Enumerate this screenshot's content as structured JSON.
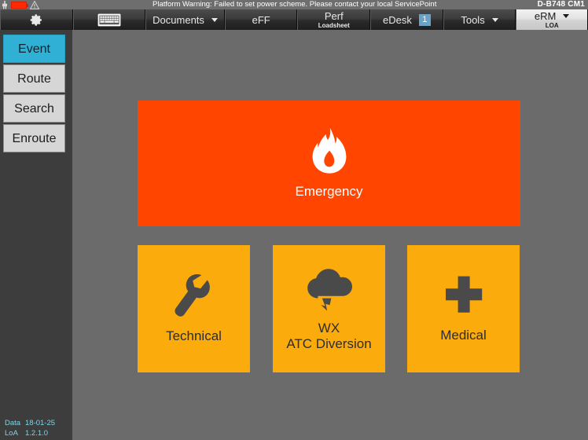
{
  "statusbar": {
    "icons": [
      "plug-icon",
      "battery-icon",
      "warning-triangle-icon"
    ],
    "message": "Platform Warning: Failed to set power scheme. Please contact your local ServicePoint",
    "aircraft_id": "D-B748",
    "crew_id": "CM1",
    "right_text": "D-B748   CM1"
  },
  "toolbar": {
    "items": [
      {
        "label": "",
        "sub": "",
        "icon": "gear-icon",
        "caret": false,
        "badge": null,
        "active": false,
        "name": "settings-button"
      },
      {
        "label": "",
        "sub": "",
        "icon": "keyboard-icon",
        "caret": false,
        "badge": null,
        "active": false,
        "name": "keyboard-button"
      },
      {
        "label": "Documents",
        "sub": "",
        "icon": null,
        "caret": true,
        "badge": null,
        "active": false,
        "name": "tab-documents"
      },
      {
        "label": "eFF",
        "sub": "",
        "icon": null,
        "caret": false,
        "badge": null,
        "active": false,
        "name": "tab-eff"
      },
      {
        "label": "Perf",
        "sub": "Loadsheet",
        "icon": null,
        "caret": false,
        "badge": null,
        "active": false,
        "name": "tab-perf"
      },
      {
        "label": "eDesk",
        "sub": "",
        "icon": null,
        "caret": false,
        "badge": "1",
        "active": false,
        "name": "tab-edesk"
      },
      {
        "label": "Tools",
        "sub": "",
        "icon": null,
        "caret": true,
        "badge": null,
        "active": false,
        "name": "tab-tools"
      },
      {
        "label": "eRM",
        "sub": "LOA",
        "icon": null,
        "caret": true,
        "badge": null,
        "active": true,
        "name": "tab-erm"
      }
    ]
  },
  "sidebar": {
    "items": [
      {
        "label": "Event",
        "active": true,
        "name": "sidebar-item-event"
      },
      {
        "label": "Route",
        "active": false,
        "name": "sidebar-item-route"
      },
      {
        "label": "Search",
        "active": false,
        "name": "sidebar-item-search"
      },
      {
        "label": "Enroute",
        "active": false,
        "name": "sidebar-item-enroute"
      }
    ],
    "footer": {
      "data_key": "Data",
      "data_value": "18-01-25",
      "loa_key": "LoA",
      "loa_value": "1.2.1.0"
    }
  },
  "main": {
    "tiles": [
      {
        "label": "Emergency",
        "icon": "flame-icon",
        "color": "#ff4500",
        "text_color": "#ffffff",
        "name": "tile-emergency"
      },
      {
        "label": "Technical",
        "icon": "wrench-icon",
        "color": "#fbab0b",
        "text_color": "#2e2e2e",
        "name": "tile-technical"
      },
      {
        "label_line1": "WX",
        "label_line2": "ATC Diversion",
        "icon": "storm-cloud-icon",
        "color": "#fbab0b",
        "text_color": "#2e2e2e",
        "name": "tile-wx-atc-diversion"
      },
      {
        "label": "Medical",
        "icon": "cross-icon",
        "color": "#fbab0b",
        "text_color": "#2e2e2e",
        "name": "tile-medical"
      }
    ]
  },
  "colors": {
    "emergency": "#ff4500",
    "amber": "#fbab0b",
    "accent_cyan": "#2fb0d4",
    "body_gray": "#6b6b6b",
    "sidebar_gray": "#3d3d3d",
    "badge_blue": "#6ba3c8",
    "version_text": "#7fd4e6"
  }
}
